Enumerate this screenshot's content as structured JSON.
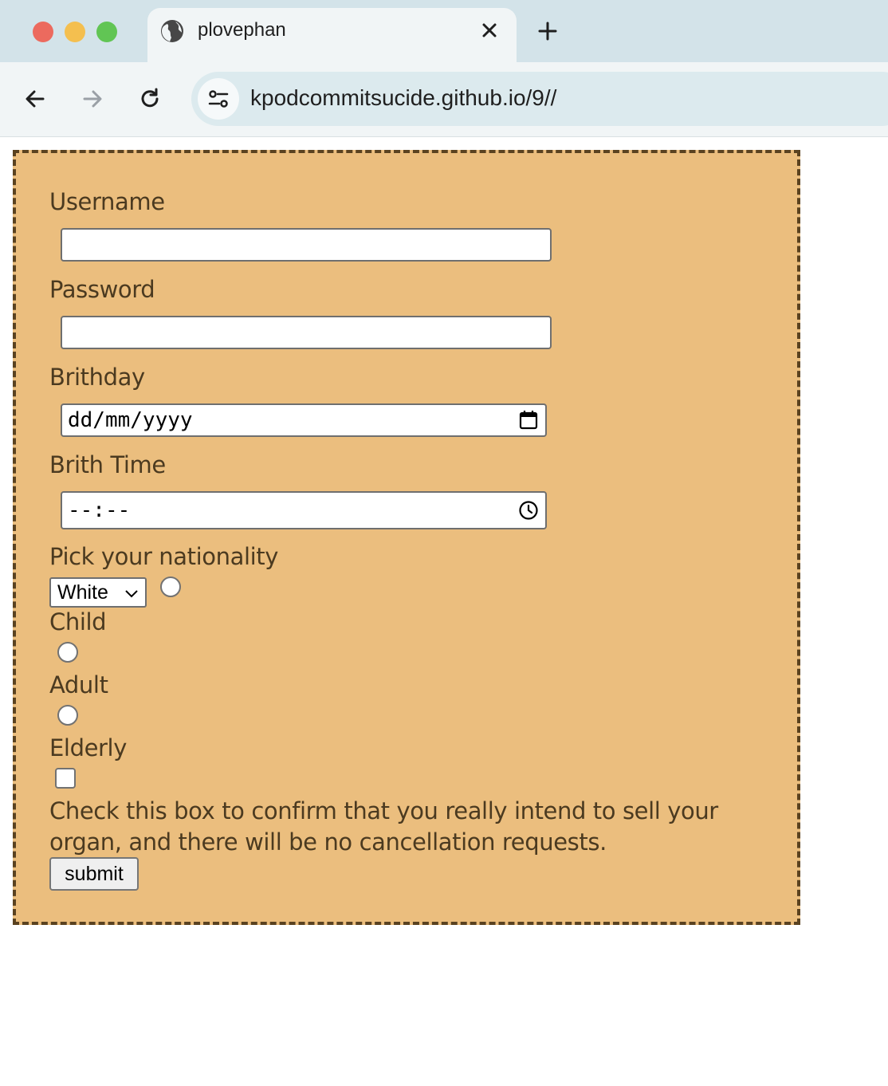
{
  "browser": {
    "tab_title": "plovephan",
    "url": "kpodcommitsucide.github.io/9//",
    "icons": {
      "tab_favicon": "globe-icon",
      "tab_close": "close-icon",
      "new_tab": "plus-icon",
      "back": "arrow-left-icon",
      "forward": "arrow-right-icon",
      "reload": "reload-icon",
      "site_info": "tune-icon"
    }
  },
  "form": {
    "username_label": "Username",
    "username_value": "",
    "password_label": "Password",
    "password_value": "",
    "birthday_label": "Brithday",
    "birthday_placeholder": "dd/mm/yyyy",
    "birthtime_label": "Brith Time",
    "birthtime_placeholder": "--:--",
    "nationality_label": "Pick your nationality",
    "nationality_selected": "White",
    "age_options": [
      {
        "label": "Child",
        "checked": false
      },
      {
        "label": "Adult",
        "checked": false
      },
      {
        "label": "Elderly",
        "checked": false
      }
    ],
    "confirm_checked": false,
    "confirm_text": "Check this box to confirm that you really intend to sell your organ, and there will be no cancellation requests.",
    "submit_label": "submit"
  },
  "colors": {
    "form_background": "#ebbe7e",
    "form_border": "#5a4220",
    "label_text": "#4b3a20"
  }
}
